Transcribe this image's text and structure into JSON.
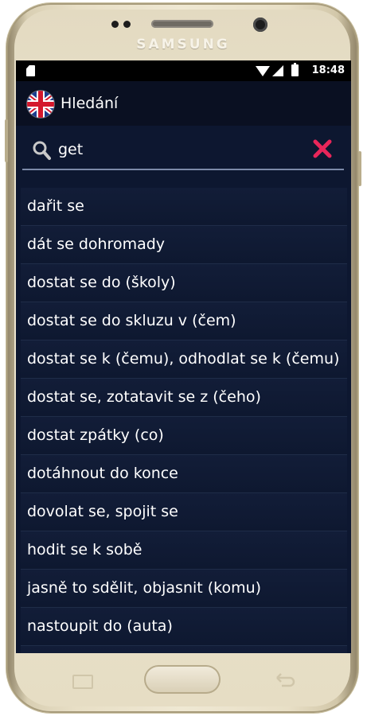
{
  "device": {
    "brand": "SAMSUNG"
  },
  "statusbar": {
    "time": "18:48"
  },
  "appbar": {
    "title": "Hledání",
    "flag_icon": "uk-flag-icon"
  },
  "search": {
    "value": "get",
    "icons": {
      "search": "search-icon",
      "clear": "close-icon"
    },
    "clear_color": "#e8265a"
  },
  "results": [
    "dařit se",
    "dát se dohromady",
    "dostat se do (školy)",
    "dostat se do skluzu v (čem)",
    "dostat se k (čemu), odhodlat se k (čemu)",
    "dostat se, zotatavit se z (čeho)",
    "dostat zpátky (co)",
    "dotáhnout do konce",
    "dovolat se, spojit se",
    "hodit se k sobě",
    "jasně to sdělit, objasnit (komu)",
    "nastoupit do (auta)"
  ],
  "colors": {
    "screen_bg": "#0d1730",
    "appbar_bg": "#0a1022",
    "divider": "#1f2c48"
  }
}
